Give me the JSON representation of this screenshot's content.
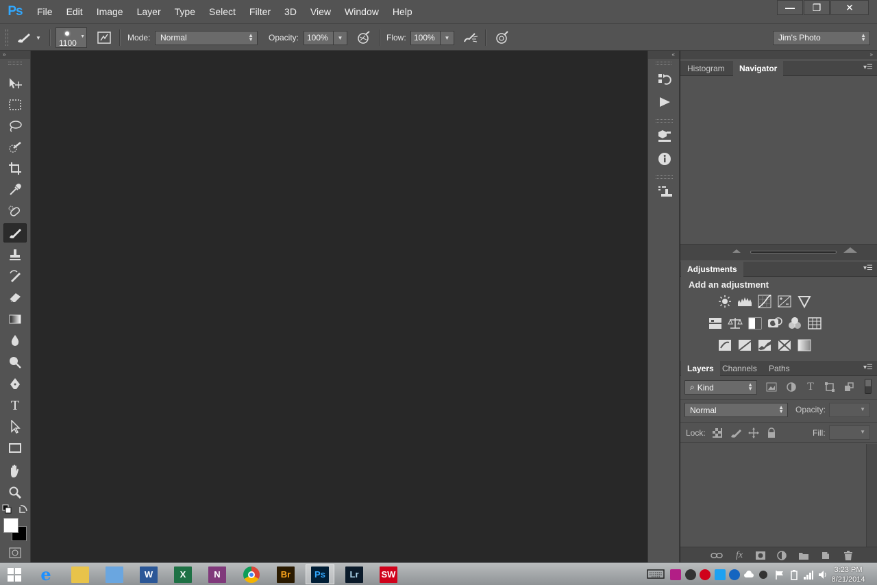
{
  "app": {
    "logo": "Ps"
  },
  "menu": [
    "File",
    "Edit",
    "Image",
    "Layer",
    "Type",
    "Select",
    "Filter",
    "3D",
    "View",
    "Window",
    "Help"
  ],
  "window_controls": {
    "minimize": "—",
    "restore": "❐",
    "close": "✕"
  },
  "options": {
    "brush_size": "1100",
    "mode_label": "Mode:",
    "mode_value": "Normal",
    "opacity_label": "Opacity:",
    "opacity_value": "100%",
    "flow_label": "Flow:",
    "flow_value": "100%",
    "workspace": "Jim's Photo"
  },
  "panels": {
    "navigator": {
      "tabs": [
        "Histogram",
        "Navigator"
      ],
      "active": "Navigator"
    },
    "adjustments": {
      "title": "Adjustments",
      "subtitle": "Add an adjustment"
    },
    "layers": {
      "tabs": [
        "Layers",
        "Channels",
        "Paths"
      ],
      "active": "Layers",
      "filter_kind": "Kind",
      "blend_mode": "Normal",
      "opacity_label": "Opacity:",
      "lock_label": "Lock:",
      "fill_label": "Fill:"
    }
  },
  "taskbar": {
    "apps": [
      {
        "name": "ie-icon",
        "label": "e",
        "color": "#1e90ff"
      },
      {
        "name": "file-explorer-icon",
        "label": "",
        "color": "#e8c34a"
      },
      {
        "name": "notepad-icon",
        "label": "",
        "color": "#6aa6e0"
      },
      {
        "name": "word-icon",
        "label": "W",
        "color": "#2b5797"
      },
      {
        "name": "excel-icon",
        "label": "X",
        "color": "#1e7145"
      },
      {
        "name": "onenote-icon",
        "label": "N",
        "color": "#80397b"
      },
      {
        "name": "chrome-icon",
        "label": "",
        "color": "#db4437"
      },
      {
        "name": "bridge-icon",
        "label": "Br",
        "color": "#2a1a00"
      },
      {
        "name": "photoshop-icon",
        "label": "Ps",
        "color": "#001e36"
      },
      {
        "name": "lightroom-icon",
        "label": "Lr",
        "color": "#0a1a2a"
      },
      {
        "name": "solidworks-icon",
        "label": "SW",
        "color": "#d0021b"
      }
    ],
    "time": "3:23 PM",
    "date": "8/21/2014"
  }
}
